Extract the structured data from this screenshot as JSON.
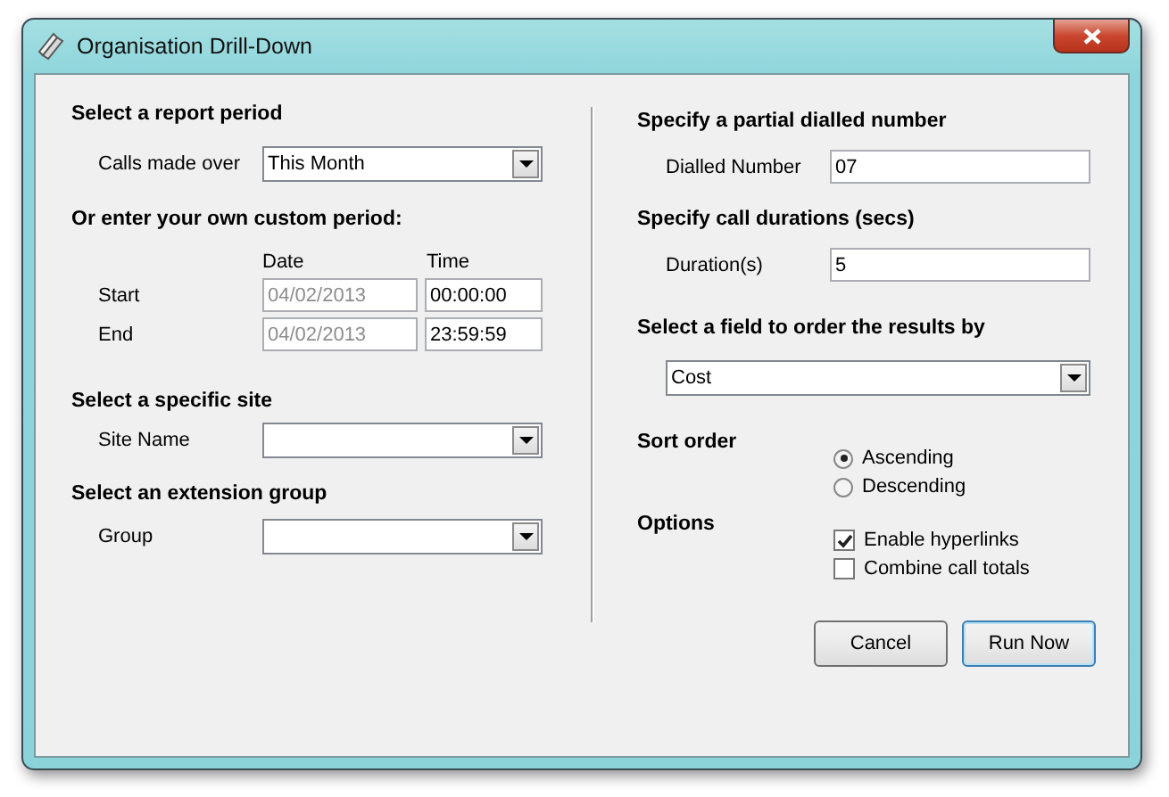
{
  "window": {
    "title": "Organisation Drill-Down"
  },
  "report_period": {
    "heading": "Select a report period",
    "label": "Calls made over",
    "value": "This Month"
  },
  "custom_period": {
    "heading": "Or enter your own custom period:",
    "date_header": "Date",
    "time_header": "Time",
    "rows": [
      {
        "label": "Start",
        "date": "04/02/2013",
        "date_disabled": true,
        "time": "00:00:00"
      },
      {
        "label": "End",
        "date": "04/02/2013",
        "date_disabled": true,
        "time": "23:59:59"
      }
    ]
  },
  "site": {
    "heading": "Select a specific site",
    "label": "Site Name"
  },
  "group": {
    "heading": "Select an extension group",
    "label": "Group"
  },
  "dialled": {
    "heading": "Specify a partial dialled number",
    "label": "Dialled Number",
    "value": "07"
  },
  "durations": {
    "heading": "Specify call durations (secs)",
    "label": "Duration(s)",
    "value": "5"
  },
  "order_by": {
    "heading": "Select a field to order the results by",
    "value": "Cost"
  },
  "sort_order": {
    "heading": "Sort order",
    "options": [
      {
        "label": "Ascending",
        "selected": true
      },
      {
        "label": "Descending",
        "selected": false
      }
    ]
  },
  "options": {
    "heading": "Options",
    "items": [
      {
        "label": "Enable hyperlinks",
        "checked": true
      },
      {
        "label": "Combine call totals",
        "checked": false
      }
    ]
  },
  "buttons": [
    {
      "label": "Cancel",
      "default": false
    },
    {
      "label": "Run Now",
      "default": true
    }
  ]
}
